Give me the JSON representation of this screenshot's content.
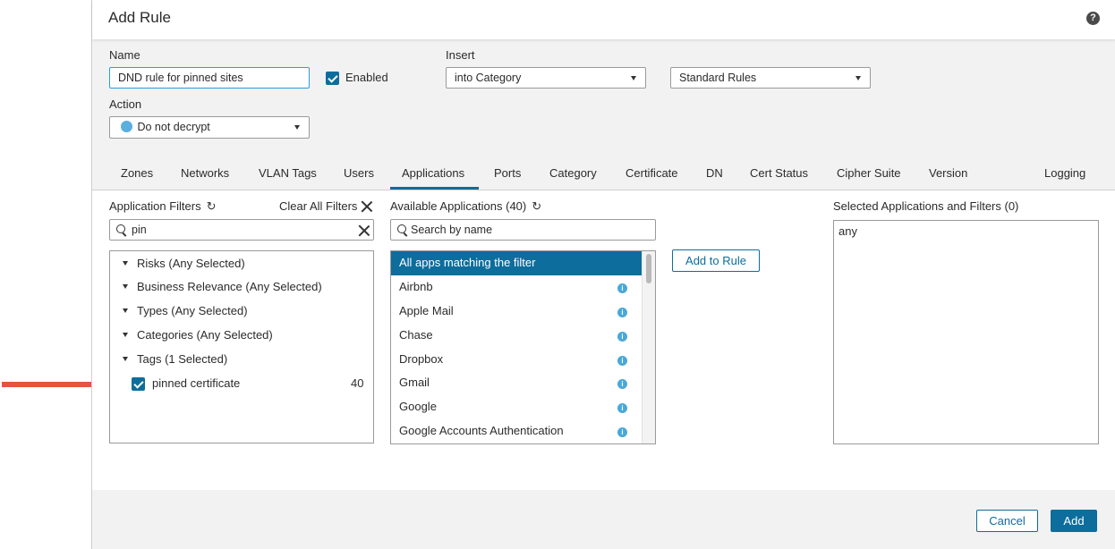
{
  "dialog": {
    "title": "Add Rule",
    "help_icon": "?"
  },
  "form": {
    "name_label": "Name",
    "name_value": "DND rule for pinned sites",
    "enabled_label": "Enabled",
    "insert_label": "Insert",
    "insert_value": "into Category",
    "category_value": "Standard Rules",
    "action_label": "Action",
    "action_value": "Do not decrypt"
  },
  "tabs": [
    "Zones",
    "Networks",
    "VLAN Tags",
    "Users",
    "Applications",
    "Ports",
    "Category",
    "Certificate",
    "DN",
    "Cert Status",
    "Cipher Suite",
    "Version",
    "Logging"
  ],
  "filters": {
    "heading": "Application Filters",
    "clear_label": "Clear All Filters",
    "search_value": "pin",
    "items": [
      "Risks (Any Selected)",
      "Business Relevance (Any Selected)",
      "Types (Any Selected)",
      "Categories (Any Selected)",
      "Tags (1 Selected)"
    ],
    "tag": {
      "label": "pinned certificate",
      "count": "40"
    }
  },
  "available": {
    "heading": "Available Applications (40)",
    "search_placeholder": "Search by name",
    "apps": [
      "All apps matching the filter",
      "Airbnb",
      "Apple Mail",
      "Chase",
      "Dropbox",
      "Gmail",
      "Google",
      "Google Accounts Authentication"
    ]
  },
  "add_to_rule_label": "Add to Rule",
  "selected": {
    "heading": "Selected Applications and Filters (0)",
    "value": "any"
  },
  "footer": {
    "cancel_label": "Cancel",
    "add_label": "Add"
  },
  "colors": {
    "accent": "#0d6d9c",
    "annotation_arrow": "#e8533f"
  }
}
